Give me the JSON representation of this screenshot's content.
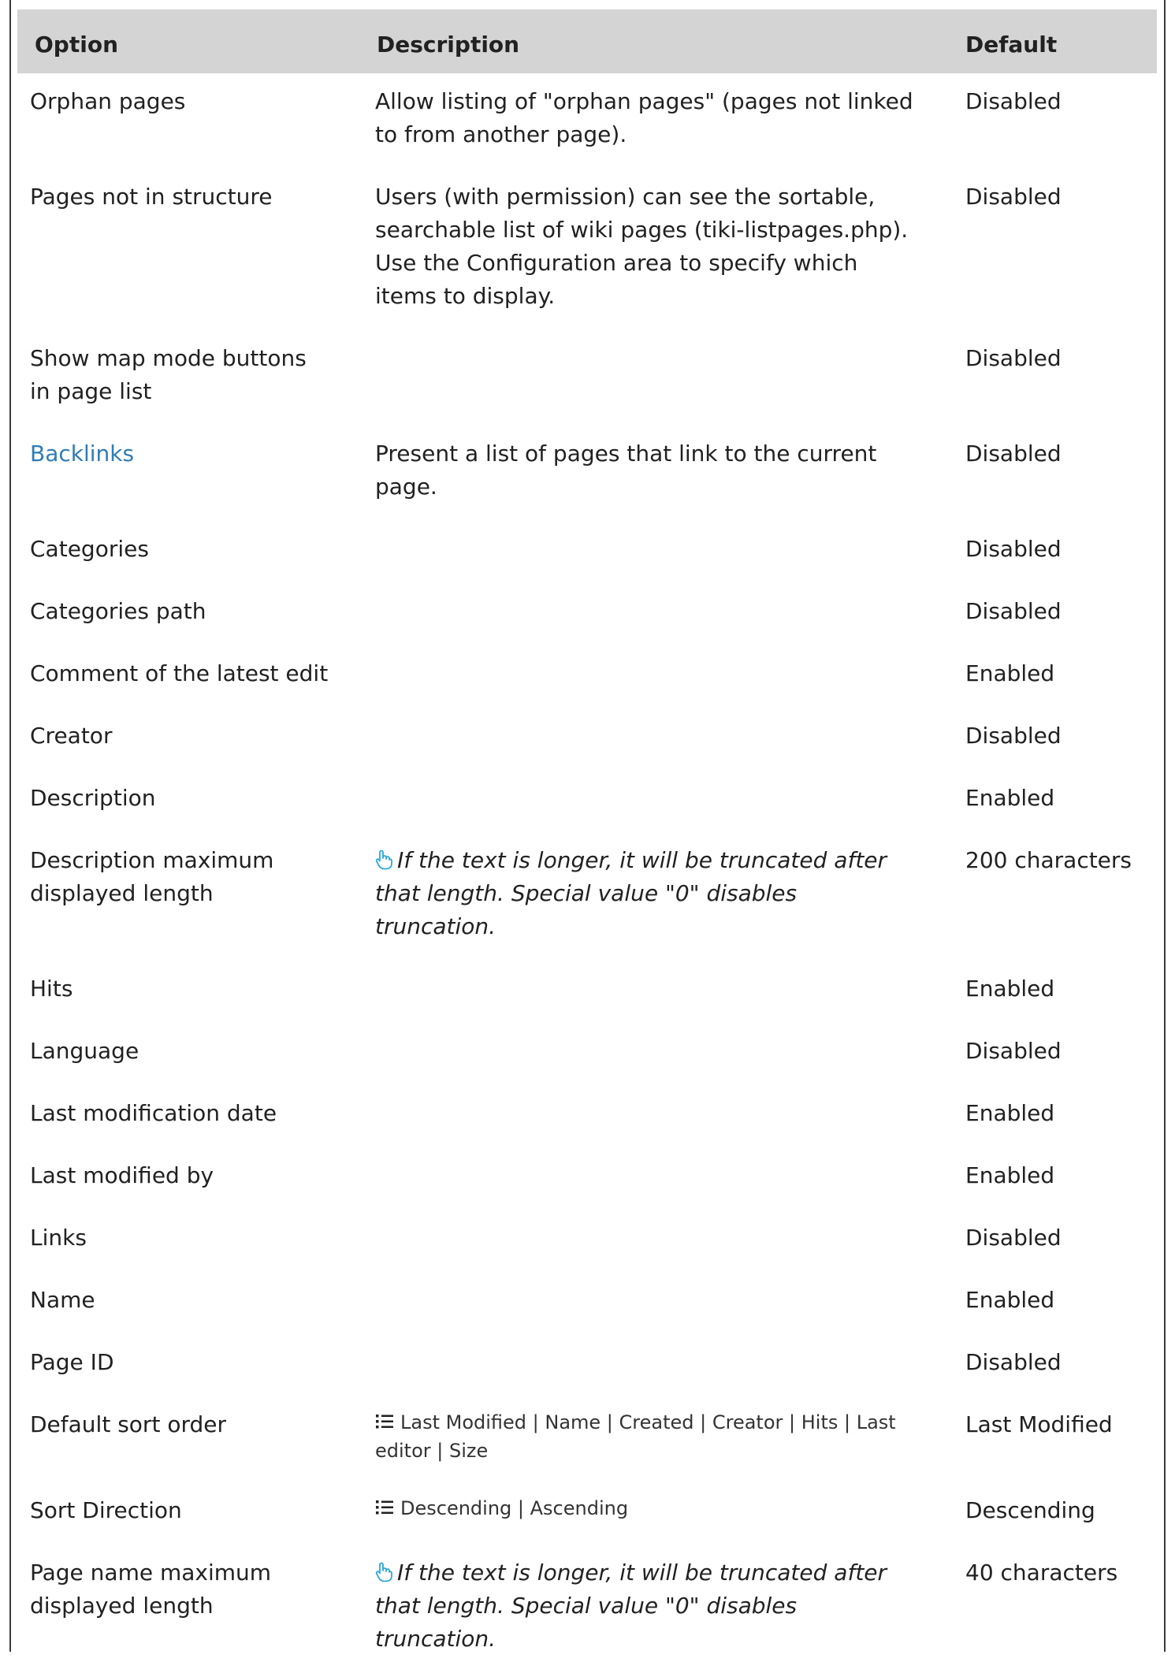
{
  "table": {
    "headers": {
      "option": "Option",
      "description": "Description",
      "default": "Default"
    },
    "rows": [
      {
        "option": "Orphan pages",
        "description": "Allow listing of \"orphan pages\" (pages not linked to from another page).",
        "default": "Disabled"
      },
      {
        "option": "Pages not in structure",
        "description": "Users (with permission) can see the sortable, searchable list of wiki pages (tiki-listpages.php). Use the Configuration area to specify which items to display.",
        "default": "Disabled"
      },
      {
        "option": "Show map mode buttons in page list",
        "description": "",
        "default": "Disabled"
      },
      {
        "option": "Backlinks",
        "description": "Present a list of pages that link to the current page.",
        "default": "Disabled"
      },
      {
        "option": "Categories",
        "description": "",
        "default": "Disabled"
      },
      {
        "option": "Categories path",
        "description": "",
        "default": "Disabled"
      },
      {
        "option": "Comment of the latest edit",
        "description": "",
        "default": "Enabled"
      },
      {
        "option": "Creator",
        "description": "",
        "default": "Disabled"
      },
      {
        "option": "Description",
        "description": "",
        "default": "Enabled"
      },
      {
        "option": "Description maximum displayed length",
        "description": "If the text is longer, it will be truncated after that length. Special value \"0\" disables truncation.",
        "default": "200 characters"
      },
      {
        "option": "Hits",
        "description": "",
        "default": "Enabled"
      },
      {
        "option": "Language",
        "description": "",
        "default": "Disabled"
      },
      {
        "option": "Last modification date",
        "description": "",
        "default": "Enabled"
      },
      {
        "option": "Last modified by",
        "description": "",
        "default": "Enabled"
      },
      {
        "option": "Links",
        "description": "",
        "default": "Disabled"
      },
      {
        "option": "Name",
        "description": "",
        "default": "Enabled"
      },
      {
        "option": "Page ID",
        "description": "",
        "default": "Disabled"
      },
      {
        "option": "Default sort order",
        "description": "Last Modified | Name | Created | Creator | Hits | Last editor | Size",
        "default": "Last Modified"
      },
      {
        "option": "Sort Direction",
        "description": "Descending | Ascending",
        "default": "Descending"
      },
      {
        "option": "Page name maximum displayed length",
        "description": "If the text is longer, it will be truncated after that length. Special value \"0\" disables truncation.",
        "default": "40 characters"
      }
    ]
  },
  "icons": {
    "hint": "pointing-hand-icon",
    "options_list": "list-icon"
  },
  "colors": {
    "header_bg": "#d4d4d4",
    "link": "#2f7cb6",
    "hint_icon": "#29a8d8",
    "border": "#3a3a3a"
  }
}
